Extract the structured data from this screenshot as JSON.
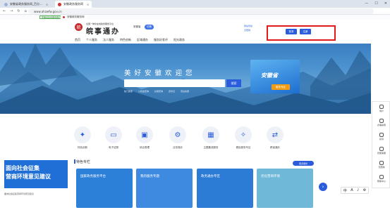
{
  "browser": {
    "tabs": [
      {
        "label": "安徽省政务服务网_百分...",
        "close": "×"
      },
      {
        "label": "安徽政务服务网",
        "close": "×"
      }
    ],
    "window_controls": [
      "—",
      "☐",
      "✕"
    ],
    "nav_icons": [
      "←",
      "→",
      "↻",
      "⌂"
    ],
    "url": "www.ahzwfw.gov.cn",
    "bookmarks": [
      "安徽省政务服务网(已...",
      "安徽政务服务网"
    ]
  },
  "header": {
    "logo_glyph": "皖",
    "subtitle": "全国一体化在线政务服务平台",
    "title": "皖事通办",
    "region": "安徽省",
    "switch_label": "切换",
    "links": [
      "网站导航",
      "无障碍"
    ],
    "login_hint": "",
    "welcome": "",
    "login_label": "登录",
    "register_label": "注册"
  },
  "nav": [
    "首页",
    "个人服务",
    "法人服务",
    "特色创新",
    "区域通办",
    "服务好差评",
    "阳光政务"
  ],
  "hero": {
    "title": "美好安徽欢迎您",
    "search_placeholder": "",
    "search_button": "搜索",
    "hot_terms": [
      "热门搜索",
      "公积金查询",
      "社保查询",
      "身份证",
      "营业执照"
    ],
    "banner_title": "安徽省",
    "banner_button": "服务专区"
  },
  "sidebar": [
    "用户",
    "办事指南",
    "投诉",
    "智能客服",
    "无障碍",
    "帮助中心"
  ],
  "quick": [
    {
      "label": "特色创新",
      "icon": "bulb-icon",
      "glyph": "✦"
    },
    {
      "label": "电子证照",
      "icon": "id-card-icon",
      "glyph": "▭"
    },
    {
      "label": "综合受理",
      "icon": "inbox-icon",
      "glyph": "▣"
    },
    {
      "label": "业务操办",
      "icon": "gear-icon",
      "glyph": "⚙"
    },
    {
      "label": "主题集成服务",
      "icon": "grid-icon",
      "glyph": "▦"
    },
    {
      "label": "便民服务专区",
      "icon": "star-icon",
      "glyph": "✧"
    },
    {
      "label": "跨省通办",
      "icon": "link-icon",
      "glyph": "⇄"
    }
  ],
  "featured": {
    "title": "特色专栏",
    "more": "更多服务",
    "cards": [
      "国家政务服务平台",
      "我的服务专题",
      "政务通办专区",
      "优化营商环境"
    ],
    "card_colors": [
      "#2d80d8",
      "#3d8ae0",
      "#2c7bd5",
      "#6fb8d8"
    ]
  },
  "ad": {
    "line1": "面向社会征集",
    "line2": "营商环境意见建议",
    "caption": "面向社会征集营商环境意见建议"
  },
  "toolbar": [
    "中",
    "A",
    "♪",
    "⚙"
  ],
  "colors": {
    "primary": "#2a5cdc",
    "highlight_box": "#e11919"
  }
}
